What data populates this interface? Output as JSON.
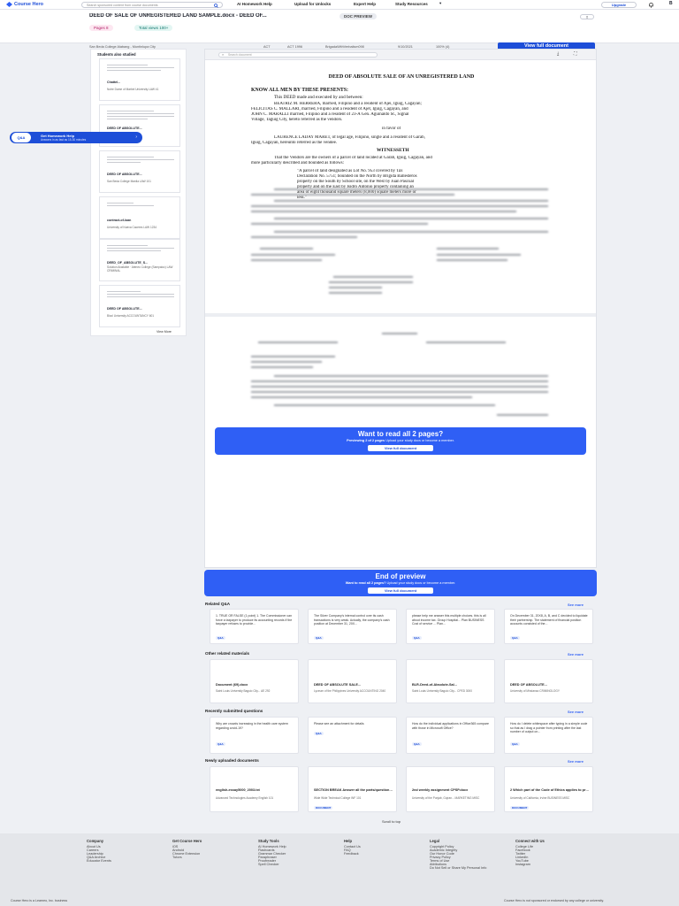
{
  "nav": {
    "logo": "Course Hero",
    "search_placeholder": "Search sponsored content from course documents",
    "links": [
      "AI Homework Help",
      "Upload for Unlocks",
      "Expert Help",
      "Study Resources"
    ],
    "upgrade": "Upgrade",
    "avatar": "B"
  },
  "doc": {
    "title": "DEED OF SALE OF UNREGISTERED LAND SAMPLE.docx - DEED OF...",
    "badge": "DOC PREVIEW",
    "pages_label": "Pages 8",
    "views_label": "Total views 100+",
    "meta": [
      "San Beda College Alabang - Muntinlupa City",
      "ACT",
      "ACT 1996",
      "BrigadaWithVerbalism098",
      "9/10/2021",
      "100% (4)"
    ],
    "view_full": "View full document"
  },
  "sidebar": {
    "title": "Students also studied",
    "items": [
      {
        "title": "Chattel...",
        "sub": "Notre Dame of Marbel University LAW 41"
      },
      {
        "title": "DEED OF ABSOLUTE...",
        "sub": ""
      },
      {
        "title": "DEED OF ABSOLUTE...",
        "sub": "San Beda College Manila LAW 101"
      },
      {
        "title": "contract-of-loan",
        "sub": "University of Nueva Caceres LAW 1234"
      },
      {
        "title": "DEED_OF_ABSOLUTE_S...",
        "sub": "Solution Available · Ateneo College (Sampaloc) LAW CRIMINAL"
      },
      {
        "title": "DEED OF ABSOLUTE...",
        "sub": "Bicol University ACCOUNTANCY 601"
      }
    ],
    "view_more": "View More"
  },
  "hw": {
    "title": "Get Homework Help",
    "sub": "Answers in as fast as 15-30 minutes",
    "badge": "Q&A"
  },
  "viewer": {
    "search_placeholder": "Search document"
  },
  "page": {
    "title": "DEED OF ABSOLUTE SALE OF AN UNREGISTERED LAND",
    "know": "KNOW ALL MEN BY THESE PRESENTS:",
    "intro": "This DEED made and executed by and between:",
    "p1": [
      "BEATRIZ M. HERRERA, married, Filipino and a resident of Ajei, Iguig, Cagayan;",
      "FELICITAS C. MALLARI, married, Filipino and a resident of Ajet, Iguig, Cagayan, and",
      "JOHN C. MARALLI married, Filipino and a resident of 23-A Gen. Aguinaldo St., Signal",
      "Village, Taguig City, hereto referred as the vendors."
    ],
    "favor": "in favor of",
    "p2": [
      "LAURENCE LADAY MARET, of legal age, Filipino, single and a resident of Garab,",
      "Iguig, Cagayan, hereunto referred as the vendee."
    ],
    "witnesseth": "WITNESSETH",
    "p3": [
      "That the Vendors are the owners of a parcel of land located at Garab, Iguig, Cagayan, and",
      "more particularly described and bounded as follows:"
    ],
    "quote": [
      "\"A parcel of land designated as Lot No. 953 covered by Tax",
      "Declaration No. 5751; bounded on the North by Brigida Ballesteros",
      "property on the South by School site, on the West by Juan Pascual",
      "property and on the East by Isidro Antonio property containing an",
      "area of eight thousand square meters (8,000) square meters more or",
      "less.\""
    ]
  },
  "preview_banner": {
    "title": "Want to read all 2 pages?",
    "sub_bold": "Previewing 2 of 2 pages",
    "sub": "Upload your study docs or become a member.",
    "button": "View full document"
  },
  "end_banner": {
    "title": "End of preview",
    "sub_bold": "Want to read all 2 pages?",
    "sub": "Upload your study docs or become a member.",
    "button": "View full document"
  },
  "related_qa": {
    "title": "Related Q&A",
    "see_more": "See more",
    "cards": [
      {
        "text": "1. TRUE OR FALSE (1 point) 1. The Commissioner can force a taxpayer to produce its accounting records if the taxpayer refuses to provide...",
        "tag": "Q&A"
      },
      {
        "text": "The Silver Company's internal control over its cash transactions is very weak. Actually, the company's cash position at December 31, 20X...",
        "tag": "Q&A"
      },
      {
        "text": "please help me answer this multiple choices. this is all about income tax. Group Hospital... Plan BUSINESS Cost of service ... Plan...",
        "tag": "Q&A"
      },
      {
        "text": "On December 31, 20X8, A, B, and C decided to liquidate their partnership. The statement of financial position accounts consisted of the...",
        "tag": "Q&A"
      }
    ]
  },
  "other_materials": {
    "title": "Other related materials",
    "see_more": "See more",
    "cards": [
      {
        "title": "Document (69).docx",
        "sub": "Saint Louis University Baguio City... AE 292"
      },
      {
        "title": "DEED OF ABSOLUTE SALE...",
        "sub": "Lyceum of the Philippines University ACCOUNTING 2040"
      },
      {
        "title": "BLR-Deed-of-Absolute-Sal...",
        "sub": "Saint Louis University Baguio City... CPED 3000"
      },
      {
        "title": "DEED OF ABSOLUTE...",
        "sub": "University of Mindanao CRIMINOLOGY"
      }
    ]
  },
  "recent_questions": {
    "title": "Recently submitted questions",
    "see_more": "See more",
    "cards": [
      {
        "text": "Why are crowds increasing in the health care system regarding covid-19?",
        "tag": "Q&A"
      },
      {
        "text": "Please see an attachment for details",
        "tag": "Q&A"
      },
      {
        "text": "How do the individual applications in Office365 compare with those in Microsoft Office?",
        "tag": "Q&A"
      },
      {
        "text": "How do I delete whitespace after typing in a simple code so that as I drag a pointer from printing after the last number of output on...",
        "tag": "Q&A"
      }
    ]
  },
  "new_docs": {
    "title": "Newly uploaded documents",
    "see_more": "See more",
    "cards": [
      {
        "title": "english-essay5000_2003.txt",
        "sub": "Advanced Technologies Academy English 101",
        "tag": ""
      },
      {
        "title": "SECTION BREAK Answer all the parts/questions 70 Use t...",
        "sub": "Wide Wide Technical College INF 101",
        "tag": "DOCUMENT"
      },
      {
        "title": "2nd weekly assignment CPSP.docx",
        "sub": "University of the Punjab, Gujran... MARKETING MISC",
        "tag": ""
      },
      {
        "title": "2 Which part of the Code of Ethics applies to profession...",
        "sub": "University of California, Irvine BUSINESS MISC",
        "tag": "DOCUMENT"
      }
    ]
  },
  "scroll_top": "Scroll to top",
  "footer": {
    "columns": [
      {
        "head": "Company",
        "links": [
          "About Us",
          "Careers",
          "Leadership",
          "Q&A Archive",
          "Educator Events"
        ]
      },
      {
        "head": "Get Course Hero",
        "links": [
          "iOS",
          "Android",
          "Chrome Extension",
          "Tutors"
        ]
      },
      {
        "head": "Study Tools",
        "links": [
          "AI Homework Help",
          "Flashcards",
          "Grammar Checker",
          "Paraphraser",
          "Proofreader",
          "Spell Checker"
        ]
      },
      {
        "head": "Help",
        "links": [
          "Contact Us",
          "FAQ",
          "Feedback"
        ]
      },
      {
        "head": "Legal",
        "links": [
          "Copyright Policy",
          "Academic Integrity",
          "Our Honor Code",
          "Privacy Policy",
          "Terms of Use",
          "Attributions",
          "Do Not Sell or Share My Personal Info"
        ]
      },
      {
        "head": "Connect with Us",
        "links": [
          "College Life",
          "Facebook",
          "Twitter",
          "LinkedIn",
          "YouTube",
          "Instagram"
        ]
      }
    ],
    "copyright": "Course Hero is a Learneo, Inc. business",
    "disclaimer": "Course Hero is not sponsored or endorsed by any college or university."
  },
  "colors": {
    "accent": "#2f5ff5",
    "button": "#1d4ed8"
  }
}
